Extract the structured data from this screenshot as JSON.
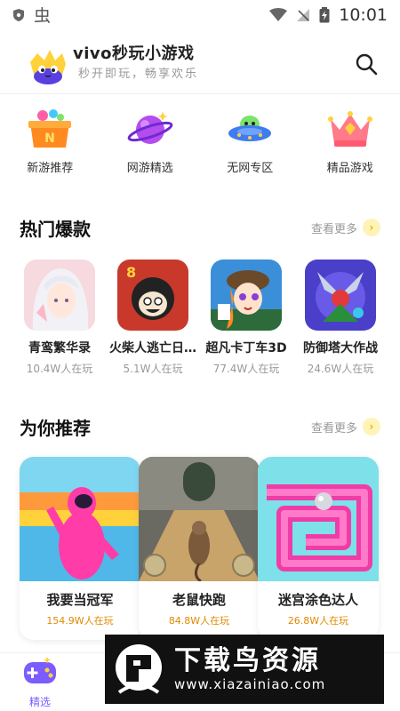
{
  "status_bar": {
    "time": "10:01"
  },
  "header": {
    "title": "vivo秒玩小游戏",
    "subtitle": "秒开即玩，畅享欢乐"
  },
  "categories": [
    {
      "label": "新游推荐",
      "icon": "new-games-box-icon"
    },
    {
      "label": "网游精选",
      "icon": "planet-icon"
    },
    {
      "label": "无网专区",
      "icon": "ufo-icon"
    },
    {
      "label": "精品游戏",
      "icon": "crown-icon"
    }
  ],
  "hot": {
    "title": "热门爆款",
    "see_more": "查看更多",
    "items": [
      {
        "name": "青鸾繁华录",
        "players": "10.4W人在玩"
      },
      {
        "name": "火柴人逃亡日…",
        "players": "5.1W人在玩"
      },
      {
        "name": "超凡卡丁车3D",
        "players": "77.4W人在玩"
      },
      {
        "name": "防御塔大作战",
        "players": "24.6W人在玩"
      }
    ]
  },
  "recommend": {
    "title": "为你推荐",
    "see_more": "查看更多",
    "items": [
      {
        "name": "我要当冠军",
        "players": "154.9W人在玩"
      },
      {
        "name": "老鼠快跑",
        "players": "84.8W人在玩"
      },
      {
        "name": "迷宫涂色达人",
        "players": "26.8W人在玩"
      }
    ]
  },
  "bottom_nav": {
    "active_label": "精选"
  },
  "watermark": {
    "name": "下载鸟资源",
    "url": "www.xiazainiao.com"
  },
  "colors": {
    "accent": "#7b5cff",
    "players_orange": "#e08a00",
    "see_more_bg": "#fff3b8"
  }
}
